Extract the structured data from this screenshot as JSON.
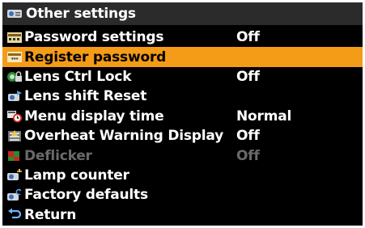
{
  "header": {
    "title": "Other settings",
    "icon": "projector-icon"
  },
  "items": [
    {
      "label": "Password settings",
      "value": "Off",
      "icon": "password-icon"
    },
    {
      "label": "Register password",
      "value": "",
      "icon": "register-password-icon",
      "selected": true
    },
    {
      "label": "Lens Ctrl Lock",
      "value": "Off",
      "icon": "lens-lock-icon"
    },
    {
      "label": "Lens shift Reset",
      "value": "",
      "icon": "lens-shift-reset-icon"
    },
    {
      "label": "Menu display time",
      "value": "Normal",
      "icon": "menu-timer-icon"
    },
    {
      "label": "Overheat Warning Display",
      "value": "Off",
      "icon": "overheat-warning-icon"
    },
    {
      "label": "Deflicker",
      "value": "Off",
      "icon": "deflicker-icon",
      "disabled": true
    },
    {
      "label": "Lamp counter",
      "value": "",
      "icon": "lamp-counter-icon"
    },
    {
      "label": "Factory defaults",
      "value": "",
      "icon": "factory-defaults-icon"
    },
    {
      "label": "Return",
      "value": "",
      "icon": "return-icon"
    }
  ],
  "colors": {
    "highlight": "#f49b18",
    "background": "#000000",
    "header": "#2b2b2b",
    "disabled_text": "#6a6a6a"
  }
}
